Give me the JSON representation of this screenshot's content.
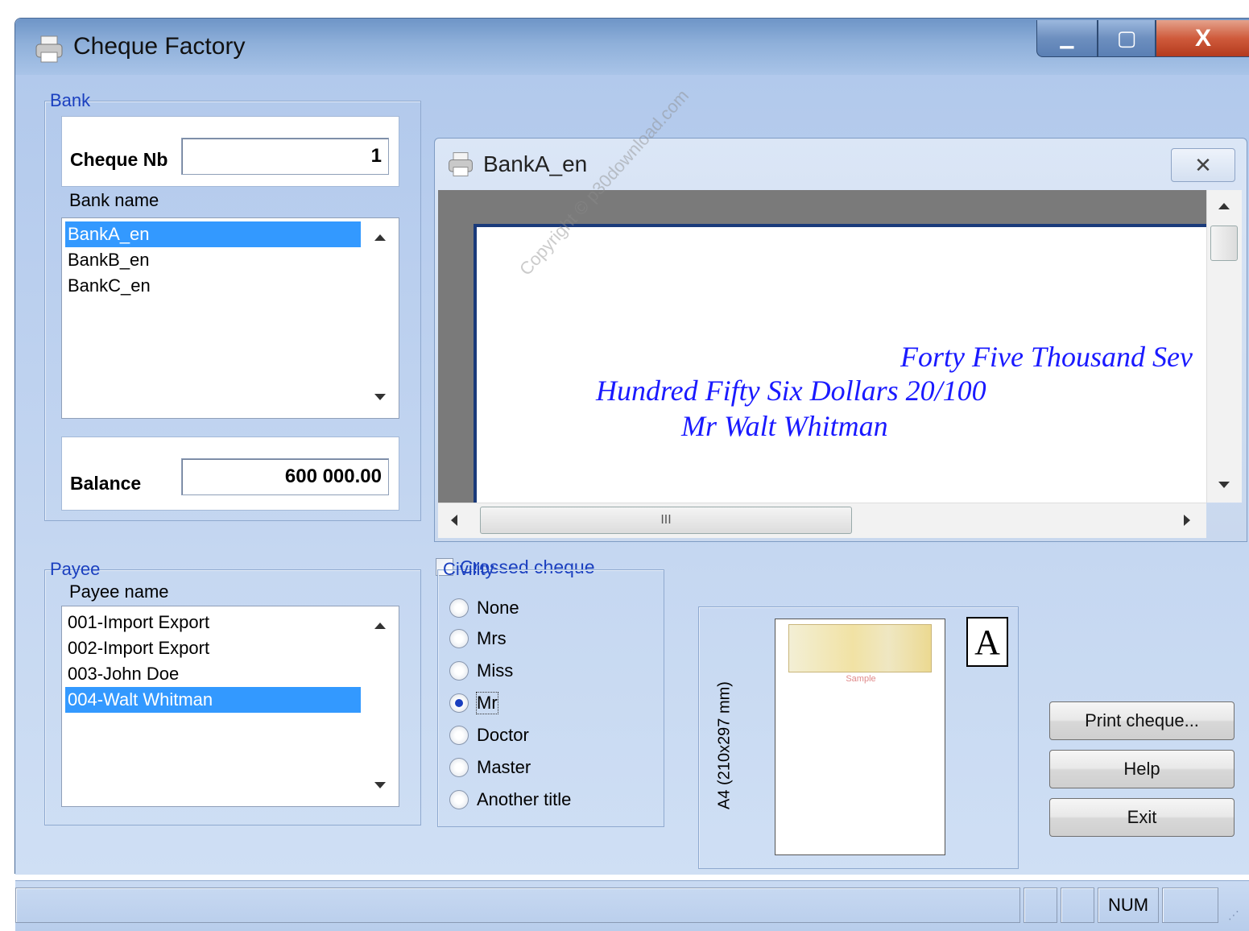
{
  "window": {
    "title": "Cheque Factory",
    "min_glyph": "▁",
    "max_glyph": "▢",
    "close_glyph": "X"
  },
  "bank": {
    "legend": "Bank",
    "cheque_nb_label": "Cheque Nb",
    "cheque_nb_value": "1",
    "bank_name_label": "Bank name",
    "banks": [
      {
        "name": "BankA_en",
        "selected": true
      },
      {
        "name": "BankB_en",
        "selected": false
      },
      {
        "name": "BankC_en",
        "selected": false
      }
    ],
    "balance_label": "Balance",
    "balance_value": "600 000.00"
  },
  "preview": {
    "title": "BankA_en",
    "close_glyph": "✕",
    "cheque_lines": [
      "Forty Five Thousand Sev",
      "Hundred Fifty Six Dollars  20/100",
      "Mr Walt Whitman"
    ],
    "watermark": "Copyright © p30download.com",
    "hthumb_grip": "III"
  },
  "crossed_cheque": {
    "label": "Crossed cheque",
    "checked": false
  },
  "payee": {
    "legend": "Payee",
    "payee_name_label": "Payee name",
    "payees": [
      {
        "name": "001-Import Export",
        "selected": false
      },
      {
        "name": "002-Import Export",
        "selected": false
      },
      {
        "name": "003-John Doe",
        "selected": false
      },
      {
        "name": "004-Walt Whitman",
        "selected": true
      }
    ]
  },
  "civility": {
    "legend": "Civility",
    "options": [
      {
        "label": "None",
        "selected": false
      },
      {
        "label": "Mrs",
        "selected": false
      },
      {
        "label": "Miss",
        "selected": false
      },
      {
        "label": "Mr",
        "selected": true
      },
      {
        "label": "Doctor",
        "selected": false
      },
      {
        "label": "Master",
        "selected": false
      },
      {
        "label": "Another title",
        "selected": false
      }
    ]
  },
  "paper": {
    "format_label": "A4 (210x297 mm)",
    "sample_text": "Sample",
    "orientation_glyph": "A"
  },
  "buttons": {
    "print": "Print cheque...",
    "help": "Help",
    "exit": "Exit"
  },
  "status_bar": {
    "num": "NUM"
  }
}
